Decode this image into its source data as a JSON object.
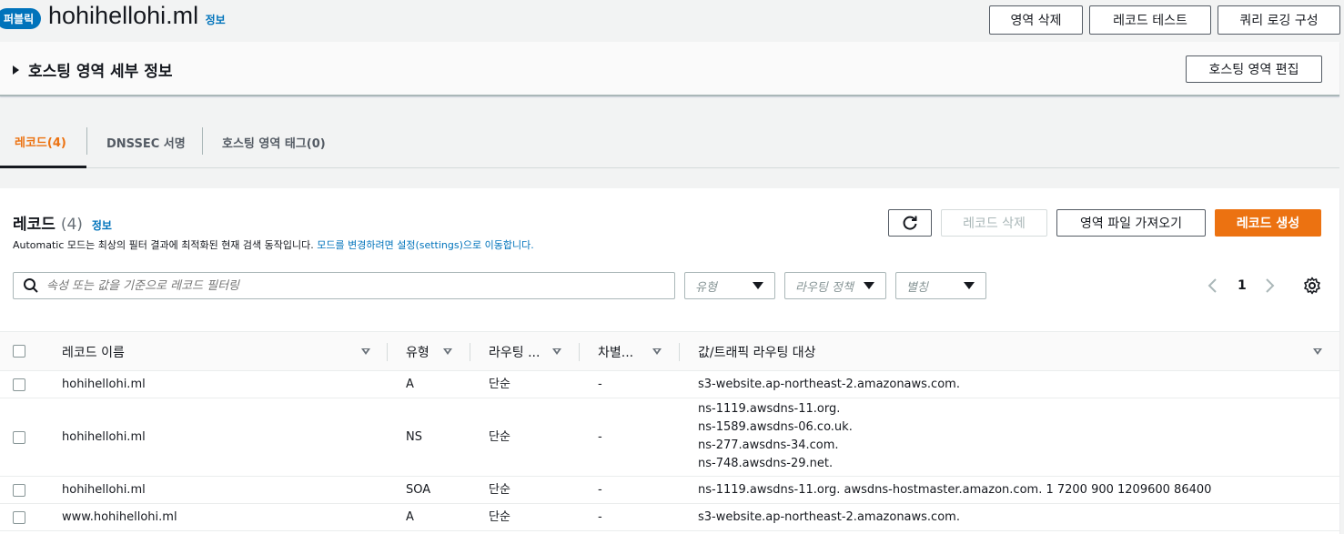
{
  "header": {
    "badge": "퍼블릭",
    "zone_name": "hohihellohi.ml",
    "info": "정보",
    "buttons": {
      "delete_zone": "영역 삭제",
      "test_record": "레코드 테스트",
      "query_logging": "쿼리 로깅 구성"
    }
  },
  "details": {
    "title": "호스팅 영역 세부 정보",
    "edit_button": "호스팅 영역 편집"
  },
  "tabs": [
    {
      "label": "레코드(4)",
      "active": true
    },
    {
      "label": "DNSSEC 서명",
      "active": false
    },
    {
      "label": "호스팅 영역 태그(0)",
      "active": false
    }
  ],
  "records": {
    "title": "레코드",
    "count": "(4)",
    "info": "정보",
    "desc_prefix": "Automatic 모드는 최상의 필터 결과에 최적화된 현재 검색 동작입니다. ",
    "desc_link": "모드를 변경하려면 설정(settings)으로 이동합니다.",
    "buttons": {
      "delete": "레코드 삭제",
      "import": "영역 파일 가져오기",
      "create": "레코드 생성"
    },
    "search_placeholder": "속성 또는 값을 기준으로 레코드 필터링",
    "filters": {
      "type": "유형",
      "routing": "라우팅 정책",
      "alias": "별칭"
    },
    "page": "1",
    "columns": {
      "name": "레코드 이름",
      "type": "유형",
      "routing": "라우팅 ...",
      "diff": "차별...",
      "value": "값/트래픽 라우팅 대상"
    },
    "rows": [
      {
        "name": "hohihellohi.ml",
        "type": "A",
        "routing": "단순",
        "diff": "-",
        "values": [
          "s3-website.ap-northeast-2.amazonaws.com."
        ]
      },
      {
        "name": "hohihellohi.ml",
        "type": "NS",
        "routing": "단순",
        "diff": "-",
        "values": [
          "ns-1119.awsdns-11.org.",
          "ns-1589.awsdns-06.co.uk.",
          "ns-277.awsdns-34.com.",
          "ns-748.awsdns-29.net."
        ]
      },
      {
        "name": "hohihellohi.ml",
        "type": "SOA",
        "routing": "단순",
        "diff": "-",
        "values": [
          "ns-1119.awsdns-11.org. awsdns-hostmaster.amazon.com. 1 7200 900 1209600 86400"
        ]
      },
      {
        "name": "www.hohihellohi.ml",
        "type": "A",
        "routing": "단순",
        "diff": "-",
        "values": [
          "s3-website.ap-northeast-2.amazonaws.com."
        ]
      }
    ]
  }
}
